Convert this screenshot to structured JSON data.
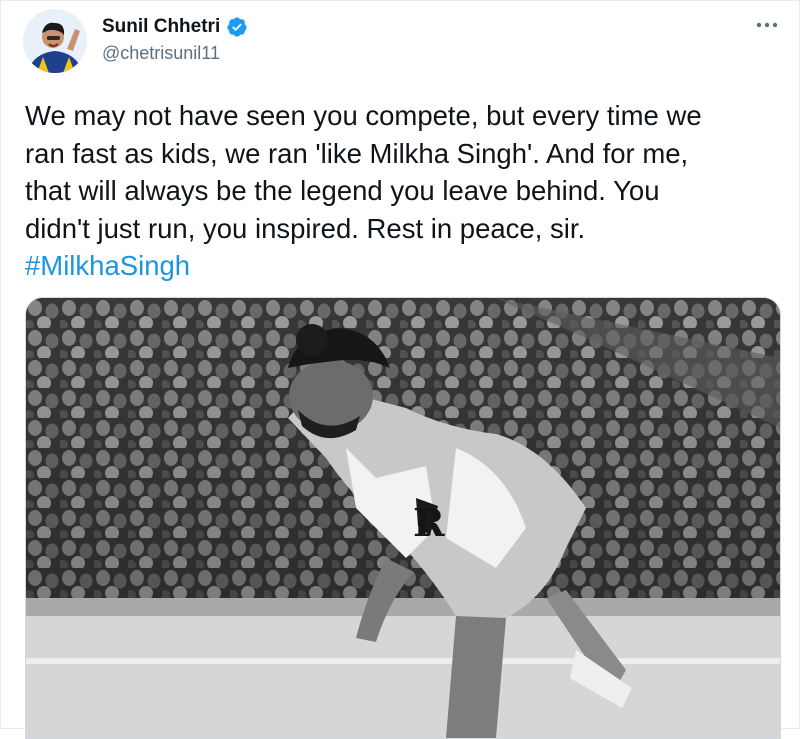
{
  "tweet": {
    "author": {
      "display_name": "Sunil Chhetri",
      "handle": "@chetrisunil11",
      "verified": true,
      "avatar_icon": "user-avatar",
      "verified_icon": "verified-badge-icon"
    },
    "more_icon": "more-options-icon",
    "text": "We may not have seen you compete, but every time we\nran fast as kids, we ran 'like Milkha Singh'. And for me,\nthat will always be the legend you leave behind. You\ndidn't just run, you inspired. Rest in peace, sir.",
    "hashtag": "#MilkhaSingh",
    "media": {
      "kind": "black-and-white photo",
      "jersey_letter": "R"
    }
  },
  "colors": {
    "link": "#1b95e0",
    "verified": "#1d9bf0",
    "secondary_text": "#5b7083"
  }
}
